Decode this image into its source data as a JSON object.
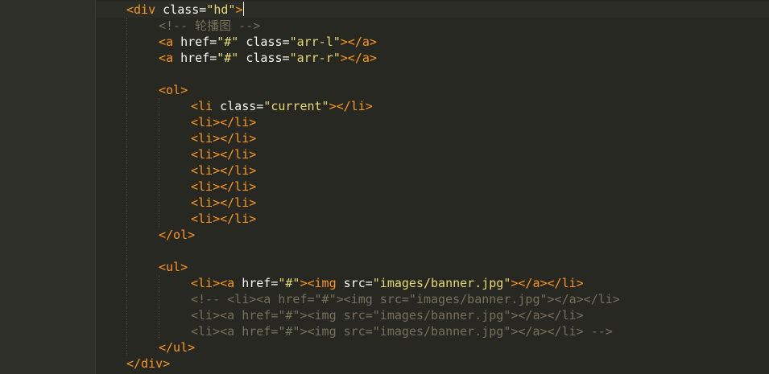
{
  "editor": {
    "lines": [
      {
        "indent": 0,
        "tokens": [
          [
            "t-orange",
            "<div"
          ],
          [
            "t-white",
            " class="
          ],
          [
            "t-yellow",
            "\"hd\""
          ],
          [
            "t-orange",
            ">"
          ]
        ],
        "cursor": true
      },
      {
        "indent": 1,
        "tokens": [
          [
            "t-grey",
            "<!-- 轮播图 -->"
          ]
        ]
      },
      {
        "indent": 1,
        "tokens": [
          [
            "t-orange",
            "<a"
          ],
          [
            "t-white",
            " href="
          ],
          [
            "t-yellow",
            "\"#\""
          ],
          [
            "t-white",
            " class="
          ],
          [
            "t-yellow",
            "\"arr-l\""
          ],
          [
            "t-orange",
            "></a>"
          ]
        ]
      },
      {
        "indent": 1,
        "tokens": [
          [
            "t-orange",
            "<a"
          ],
          [
            "t-white",
            " href="
          ],
          [
            "t-yellow",
            "\"#\""
          ],
          [
            "t-white",
            " class="
          ],
          [
            "t-yellow",
            "\"arr-r\""
          ],
          [
            "t-orange",
            "></a>"
          ]
        ]
      },
      {
        "indent": 1,
        "tokens": []
      },
      {
        "indent": 1,
        "tokens": [
          [
            "t-orange",
            "<ol>"
          ]
        ]
      },
      {
        "indent": 2,
        "tokens": [
          [
            "t-orange",
            "<li"
          ],
          [
            "t-white",
            " class="
          ],
          [
            "t-yellow",
            "\"current\""
          ],
          [
            "t-orange",
            "></li>"
          ]
        ]
      },
      {
        "indent": 2,
        "tokens": [
          [
            "t-orange",
            "<li></li>"
          ]
        ]
      },
      {
        "indent": 2,
        "tokens": [
          [
            "t-orange",
            "<li></li>"
          ]
        ]
      },
      {
        "indent": 2,
        "tokens": [
          [
            "t-orange",
            "<li></li>"
          ]
        ]
      },
      {
        "indent": 2,
        "tokens": [
          [
            "t-orange",
            "<li></li>"
          ]
        ]
      },
      {
        "indent": 2,
        "tokens": [
          [
            "t-orange",
            "<li></li>"
          ]
        ]
      },
      {
        "indent": 2,
        "tokens": [
          [
            "t-orange",
            "<li></li>"
          ]
        ]
      },
      {
        "indent": 2,
        "tokens": [
          [
            "t-orange",
            "<li></li>"
          ]
        ]
      },
      {
        "indent": 1,
        "tokens": [
          [
            "t-orange",
            "</ol>"
          ]
        ]
      },
      {
        "indent": 1,
        "tokens": []
      },
      {
        "indent": 1,
        "tokens": [
          [
            "t-orange",
            "<ul>"
          ]
        ]
      },
      {
        "indent": 2,
        "tokens": [
          [
            "t-orange",
            "<li><a"
          ],
          [
            "t-white",
            " href="
          ],
          [
            "t-yellow",
            "\"#\""
          ],
          [
            "t-orange",
            "><img"
          ],
          [
            "t-white",
            " src="
          ],
          [
            "t-yellow",
            "\"images/banner.jpg\""
          ],
          [
            "t-orange",
            "></a></li>"
          ]
        ]
      },
      {
        "indent": 2,
        "tokens": [
          [
            "t-grey",
            "<!-- <li><a href=\"#\"><img src=\"images/banner.jpg\"></a></li>"
          ]
        ]
      },
      {
        "indent": 2,
        "tokens": [
          [
            "t-grey",
            "<li><a href=\"#\"><img src=\"images/banner.jpg\"></a></li>"
          ]
        ]
      },
      {
        "indent": 2,
        "tokens": [
          [
            "t-grey",
            "<li><a href=\"#\"><img src=\"images/banner.jpg\"></a></li> -->"
          ]
        ]
      },
      {
        "indent": 1,
        "tokens": [
          [
            "t-orange",
            "</ul>"
          ]
        ]
      },
      {
        "indent": 0,
        "tokens": [
          [
            "t-orange",
            "</div>"
          ]
        ]
      }
    ]
  },
  "colors": {
    "background": "#272822",
    "tag": "#fd971f",
    "attribute": "#f8f8f2",
    "string": "#e6db74",
    "comment": "#75715e"
  }
}
